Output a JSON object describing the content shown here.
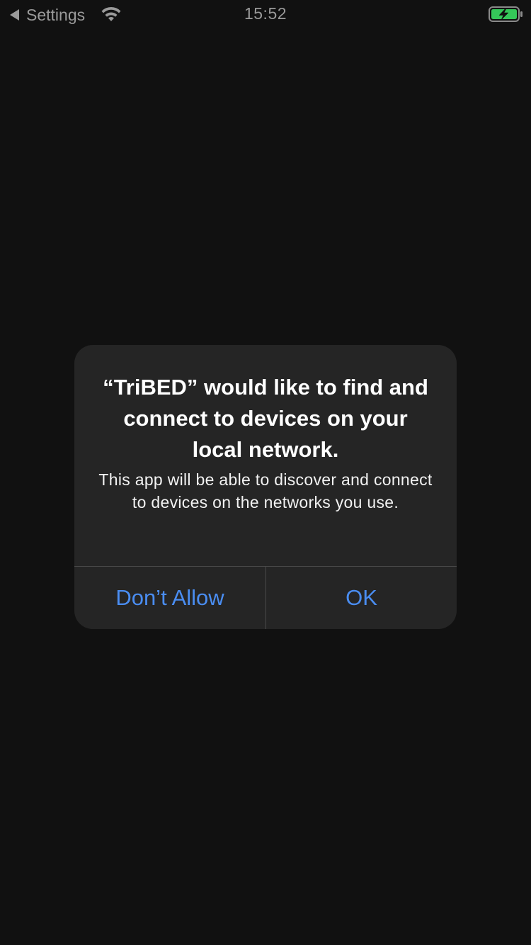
{
  "status_bar": {
    "back_label": "Settings",
    "time": "15:52",
    "wifi_icon": "wifi-icon",
    "battery_icon": "battery-charging-icon",
    "battery_color": "#35c759"
  },
  "alert": {
    "title": "“TriBED” would like to find and connect to devices on your local network.",
    "message": "This app will be able to discover and connect to devices on the networks you use.",
    "buttons": {
      "dont_allow": "Don’t Allow",
      "ok": "OK"
    },
    "button_color": "#4a8df1"
  }
}
